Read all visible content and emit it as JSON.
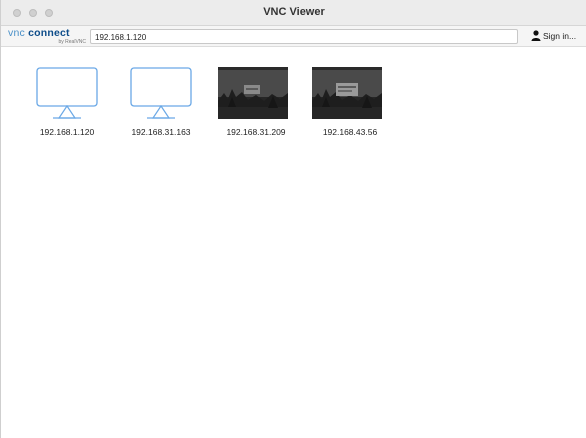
{
  "window": {
    "title": "VNC Viewer"
  },
  "toolbar": {
    "logo_vnc": "vnc",
    "logo_connect": "connect",
    "logo_sub": "by RealVNC",
    "address_value": "192.168.1.120",
    "signin_label": "Sign in...",
    "signin_icon": "person-icon"
  },
  "connections": [
    {
      "label": "192.168.1.120",
      "thumbnail": "monitor-icon"
    },
    {
      "label": "192.168.31.163",
      "thumbnail": "monitor-icon"
    },
    {
      "label": "192.168.31.209",
      "thumbnail": "screen-preview"
    },
    {
      "label": "192.168.43.56",
      "thumbnail": "screen-preview"
    }
  ],
  "colors": {
    "accent_blue": "#4a90c8",
    "logo_dark_blue": "#0e4d8a",
    "monitor_outline": "#6aa8e6"
  }
}
